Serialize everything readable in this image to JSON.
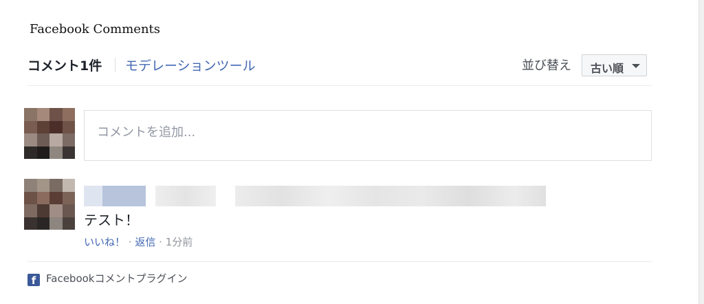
{
  "section_title": "Facebook Comments",
  "header": {
    "count_label": "コメント1件",
    "moderation_link": "モデレーションツール",
    "sort_label": "並び替え",
    "sort_value": "古い順"
  },
  "composer": {
    "placeholder": "コメントを追加..."
  },
  "comment": {
    "text": "テスト！",
    "like": "いいね！",
    "reply": "返信",
    "sep": "·",
    "time": "1分前"
  },
  "footer": {
    "logo_letter": "f",
    "label": "Facebookコメントプラグイン"
  },
  "colors": {
    "link": "#4267b2",
    "muted": "#90949c",
    "brand": "#3b5998"
  }
}
